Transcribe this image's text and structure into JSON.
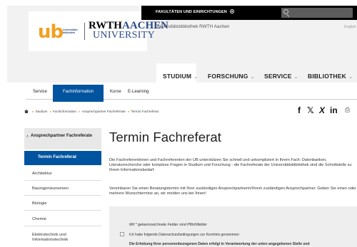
{
  "topbar": {
    "faculties_label": "FAKULTÄTEN UND EINRICHTUNGEN"
  },
  "header": {
    "logo_ub": "ub",
    "logo_ub_sub_1": "Universitäts",
    "logo_ub_sub_2": "bibliothek",
    "logo_rwth": "RWTH",
    "logo_aachen": "AACHEN",
    "logo_university": "UNIVERSITY",
    "library_title": "Universitätsbibliothek RWTH Aachen",
    "language_link": "English"
  },
  "mainnav": {
    "items": [
      {
        "label": "STUDIUM"
      },
      {
        "label": "FORSCHUNG"
      },
      {
        "label": "SERVICE"
      },
      {
        "label": "BIBLIOTHEK"
      }
    ],
    "chevron": "⌄"
  },
  "subnav": {
    "items": [
      {
        "label": "Service"
      },
      {
        "label": "Fachinformation"
      },
      {
        "label": "Kurse"
      },
      {
        "label": "E-Learning"
      }
    ]
  },
  "breadcrumb": {
    "items": [
      "Studium",
      "Fachinformation",
      "Ansprechpartner Fachreferate",
      "Termin Fachreferat"
    ]
  },
  "social": {
    "facebook": "f",
    "twitter": "𝕏",
    "xing": "X",
    "linkedin": "in",
    "print": "⎙"
  },
  "sidebar": {
    "heading": "Ansprechpartner Fachreferate",
    "active": "Termin Fachreferat",
    "items": [
      {
        "label": "Architektur"
      },
      {
        "label": "Bauingenieurwesen"
      },
      {
        "label": "Biologie"
      },
      {
        "label": "Chemie"
      },
      {
        "label": "Elektrotechnik und Informationstechnik"
      }
    ]
  },
  "content": {
    "title": "Termin Fachreferat",
    "para1": "Die Fachreferentinnen und Fachreferenten der UB unterstützen Sie schnell und unkompliziert in Ihrem Fach: Datenbanken, Literaturrecherche oder komplexe Fragen in Studium und Forschung - die Fachreferate der Universitätsbibliothek sind die Schnittstelle zu Ihrem Informationsbedarf.",
    "para2": "Vereinbaren Sie einen Beratungstermin mit Ihrer zuständigen Ansprechpartnerin/Ihrem zuständigen Ansprechpartner. Geben Sie einen oder mehrere Wunschtermine an, wir melden uns bei Ihnen!",
    "required_note": "Mit * gekennzeichnete Felder sind Pflichtfelder",
    "privacy_label": "Ich habe folgende Datenschutzbedingungen zur Kenntnis genommen:",
    "privacy_text": "Die Erhebung Ihrer personenbezogenen Daten erfolgt in Verantwortung der unten angegebenen Stelle und"
  },
  "colors": {
    "brand_blue": "#00549f",
    "ub_orange": "#f0a020"
  }
}
